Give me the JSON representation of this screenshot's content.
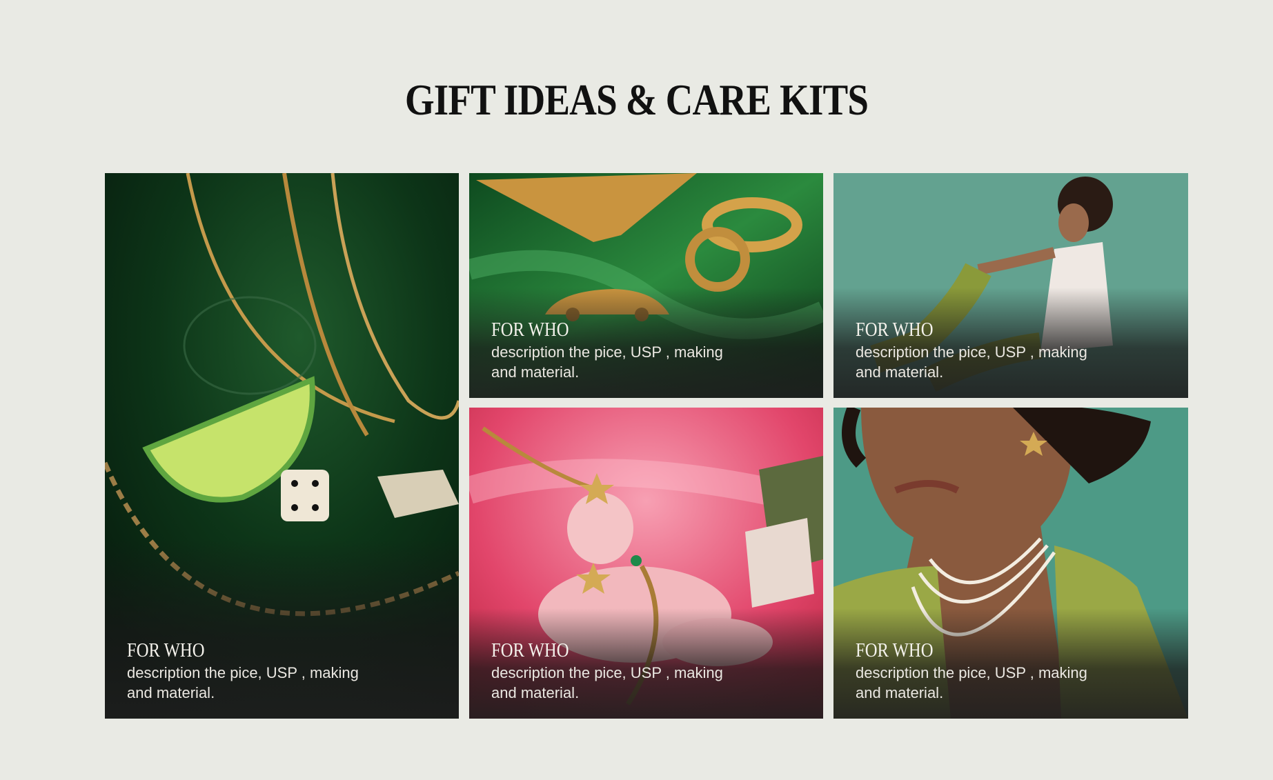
{
  "page": {
    "title": "GIFT IDEAS & CARE KITS",
    "background_color": "#e9eae4"
  },
  "cards": [
    {
      "heading": "FOR WHO",
      "description": "description the pice, USP , making and material.",
      "image": "gold-chains-lime-dice-on-green-satin"
    },
    {
      "heading": "FOR WHO",
      "description": "description the pice, USP , making and material.",
      "image": "gold-rings-and-car-charm-on-green-satin"
    },
    {
      "heading": "FOR WHO",
      "description": "description the pice, USP , making and material.",
      "image": "seated-model-teal-background"
    },
    {
      "heading": "FOR WHO",
      "description": "description the pice, USP , making and material.",
      "image": "cherub-figurine-on-pink-satin"
    },
    {
      "heading": "FOR WHO",
      "description": "description the pice, USP , making and material.",
      "image": "model-wearing-pearl-necklaces"
    }
  ]
}
